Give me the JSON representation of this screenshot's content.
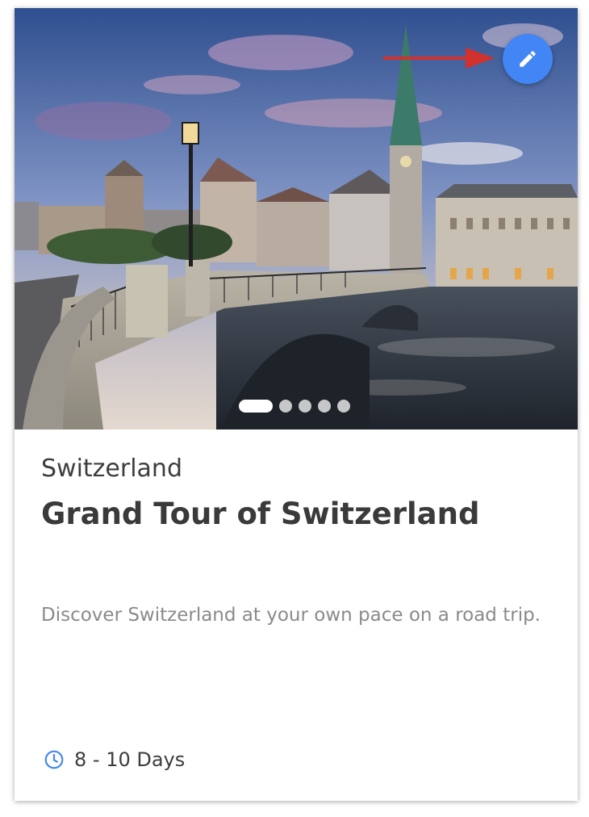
{
  "card": {
    "country": "Switzerland",
    "title": "Grand Tour of Switzerland",
    "description": "Discover Switzerland at your own pace on a road trip.",
    "duration": "8 - 10 Days",
    "image_description": "Zurich bridge over river with church spire at dusk",
    "edit_icon": "pencil-icon",
    "duration_icon": "clock-icon",
    "carousel": {
      "total_slides": 5,
      "active_index": 0
    }
  },
  "colors": {
    "accent": "#4285f4",
    "annotation_arrow": "#d0312d",
    "title_text": "#3a3a3a",
    "description_text": "#8a8a8a"
  }
}
